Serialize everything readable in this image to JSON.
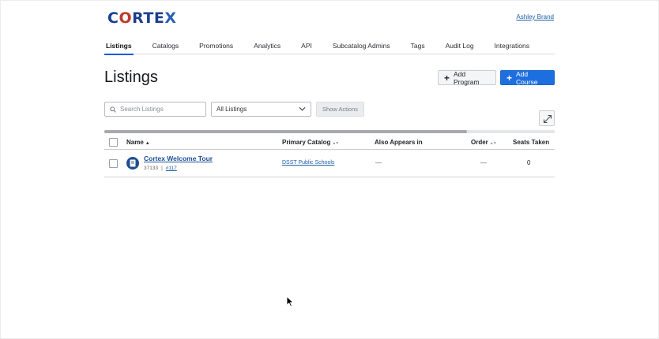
{
  "header": {
    "logo": {
      "text_a": "C",
      "text_brain": "O",
      "text_b": "RTE",
      "text_x": "X"
    },
    "user_name": "Ashley Brand"
  },
  "tabs": [
    {
      "label": "Listings",
      "active": true
    },
    {
      "label": "Catalogs",
      "active": false
    },
    {
      "label": "Promotions",
      "active": false
    },
    {
      "label": "Analytics",
      "active": false
    },
    {
      "label": "API",
      "active": false
    },
    {
      "label": "Subcatalog Admins",
      "active": false
    },
    {
      "label": "Tags",
      "active": false
    },
    {
      "label": "Audit Log",
      "active": false
    },
    {
      "label": "Integrations",
      "active": false
    }
  ],
  "page": {
    "title": "Listings",
    "add_program_label": "Add Program",
    "add_course_label": "Add Course"
  },
  "filters": {
    "search_placeholder": "Search Listings",
    "search_value": "",
    "select_value": "All Listings",
    "show_actions_label": "Show Actions"
  },
  "scroll": {
    "thumb_fraction": 0.805
  },
  "table": {
    "columns": {
      "name": "Name",
      "primary_catalog": "Primary Catalog",
      "also_appears_in": "Also Appears in",
      "order": "Order",
      "seats_taken": "Seats Taken"
    },
    "rows": [
      {
        "name": "Cortex Welcome Tour",
        "id": "37133",
        "separator": "|",
        "number_link": "#117",
        "primary_catalog": "DSST Public Schools",
        "also_appears_in": "—",
        "order": "—",
        "seats_taken": "0"
      }
    ]
  },
  "colors": {
    "primary": "#1d6fe0",
    "link": "#1e5fa8",
    "tab_underline": "#0d5bd6",
    "logo_navy": "#1b3f8f"
  }
}
